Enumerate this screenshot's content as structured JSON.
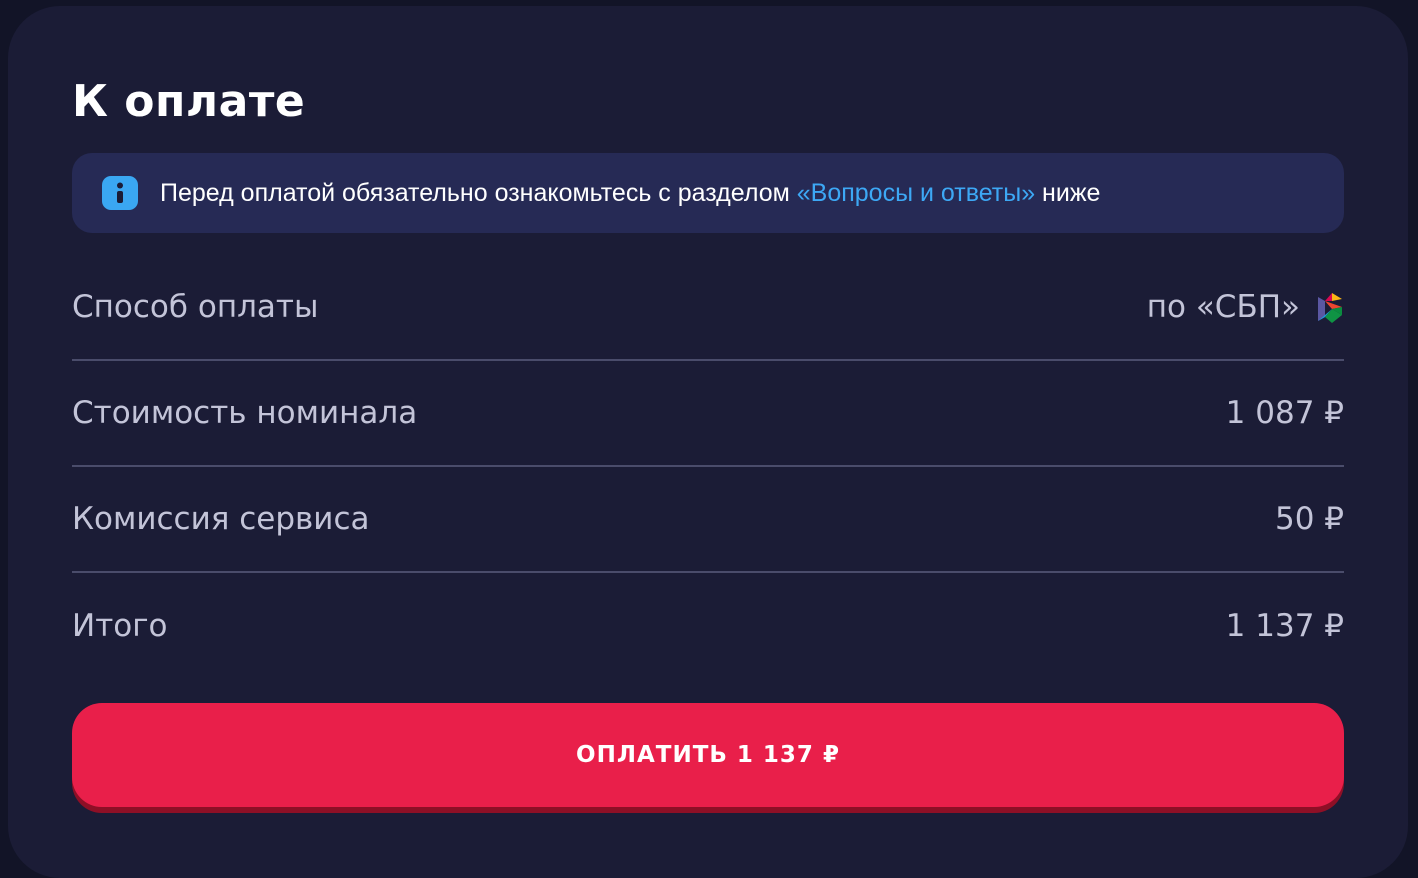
{
  "card": {
    "title": "К оплате"
  },
  "notice": {
    "icon": "info-icon",
    "text_before": "Перед оплатой обязательно ознакомьтесь с разделом ",
    "link_text": "«Вопросы и ответы»",
    "text_after": " ниже",
    "link_color": "#3da8f5"
  },
  "summary": {
    "rows": [
      {
        "label": "Способ оплаты",
        "value": "по «СБП»",
        "icon": "sbp-logo-icon"
      },
      {
        "label": "Стоимость номинала",
        "value": "1 087 ₽"
      },
      {
        "label": "Комиссия сервиса",
        "value": "50 ₽"
      },
      {
        "label": "Итого",
        "value": "1 137 ₽"
      }
    ]
  },
  "pay_button": {
    "label": "ОПЛАТИТЬ 1 137 ₽",
    "color": "#e91f4a"
  }
}
